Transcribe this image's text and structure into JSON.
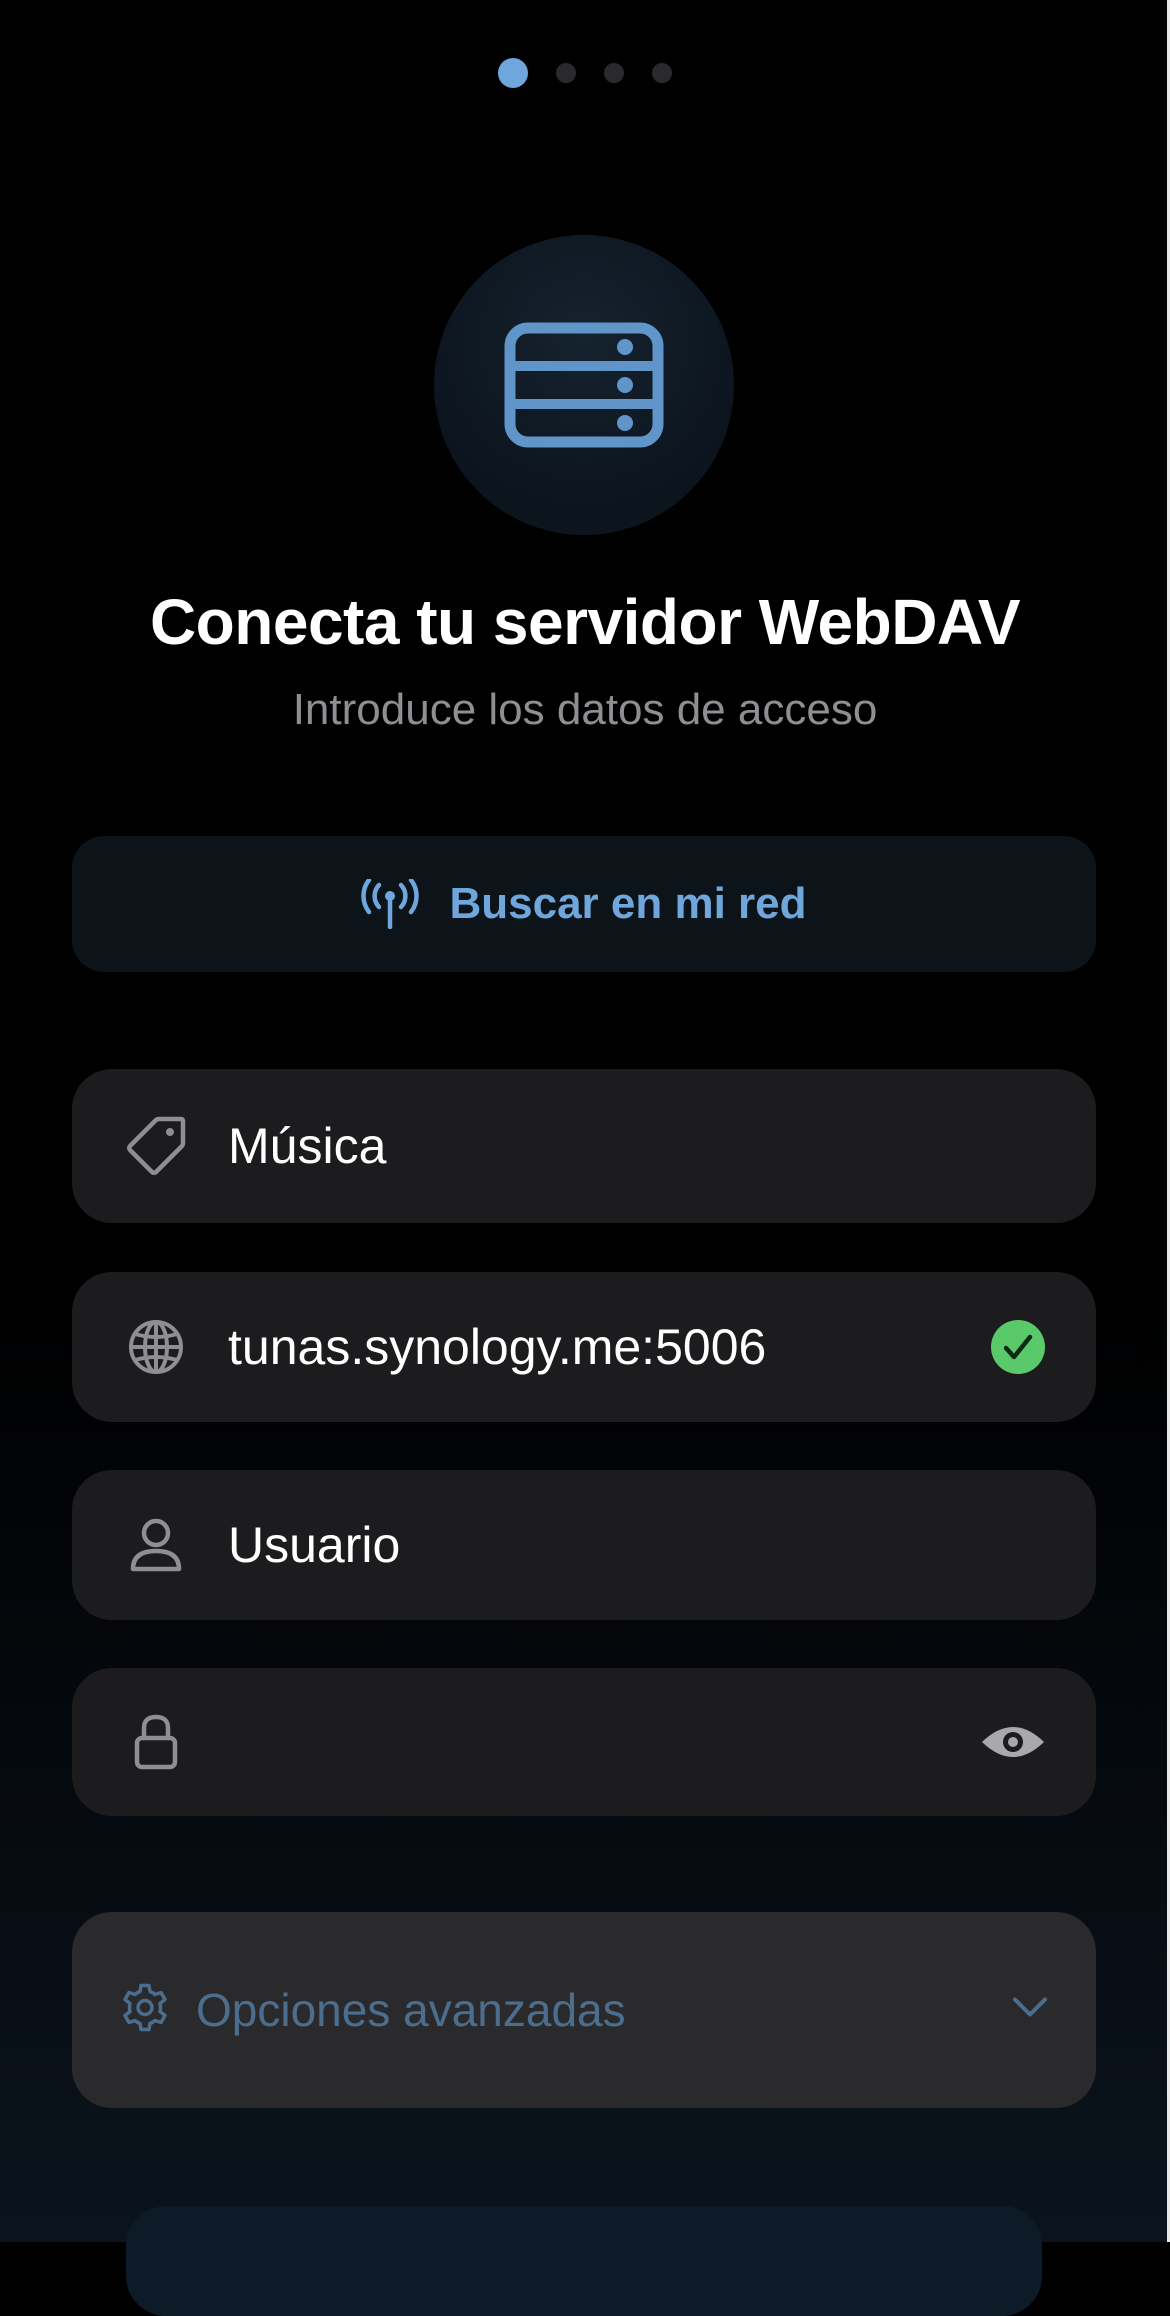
{
  "pager": {
    "count": 4,
    "active_index": 0
  },
  "hero": {
    "icon": "server-icon"
  },
  "header": {
    "title": "Conecta tu servidor WebDAV",
    "subtitle": "Introduce los datos de acceso"
  },
  "scan": {
    "icon": "antenna-icon",
    "label": "Buscar en mi red"
  },
  "form": {
    "name": {
      "icon": "tag-icon",
      "value": "Música"
    },
    "url": {
      "icon": "globe-icon",
      "value": "tunas.synology.me:5006",
      "status_icon": "checkmark-circle-icon",
      "status_color": "#5ac96a"
    },
    "user": {
      "icon": "person-icon",
      "placeholder": "Usuario"
    },
    "password": {
      "icon": "lock-icon",
      "value": "",
      "toggle_icon": "eye-icon"
    }
  },
  "advanced": {
    "icon": "gear-icon",
    "label": "Opciones avanzadas",
    "chevron_icon": "chevron-down-icon"
  },
  "colors": {
    "accent": "#6fa7dc",
    "field_bg": "#1c1c1e",
    "muted_text": "#8e8e93",
    "advanced_text": "#4b6e8e"
  }
}
